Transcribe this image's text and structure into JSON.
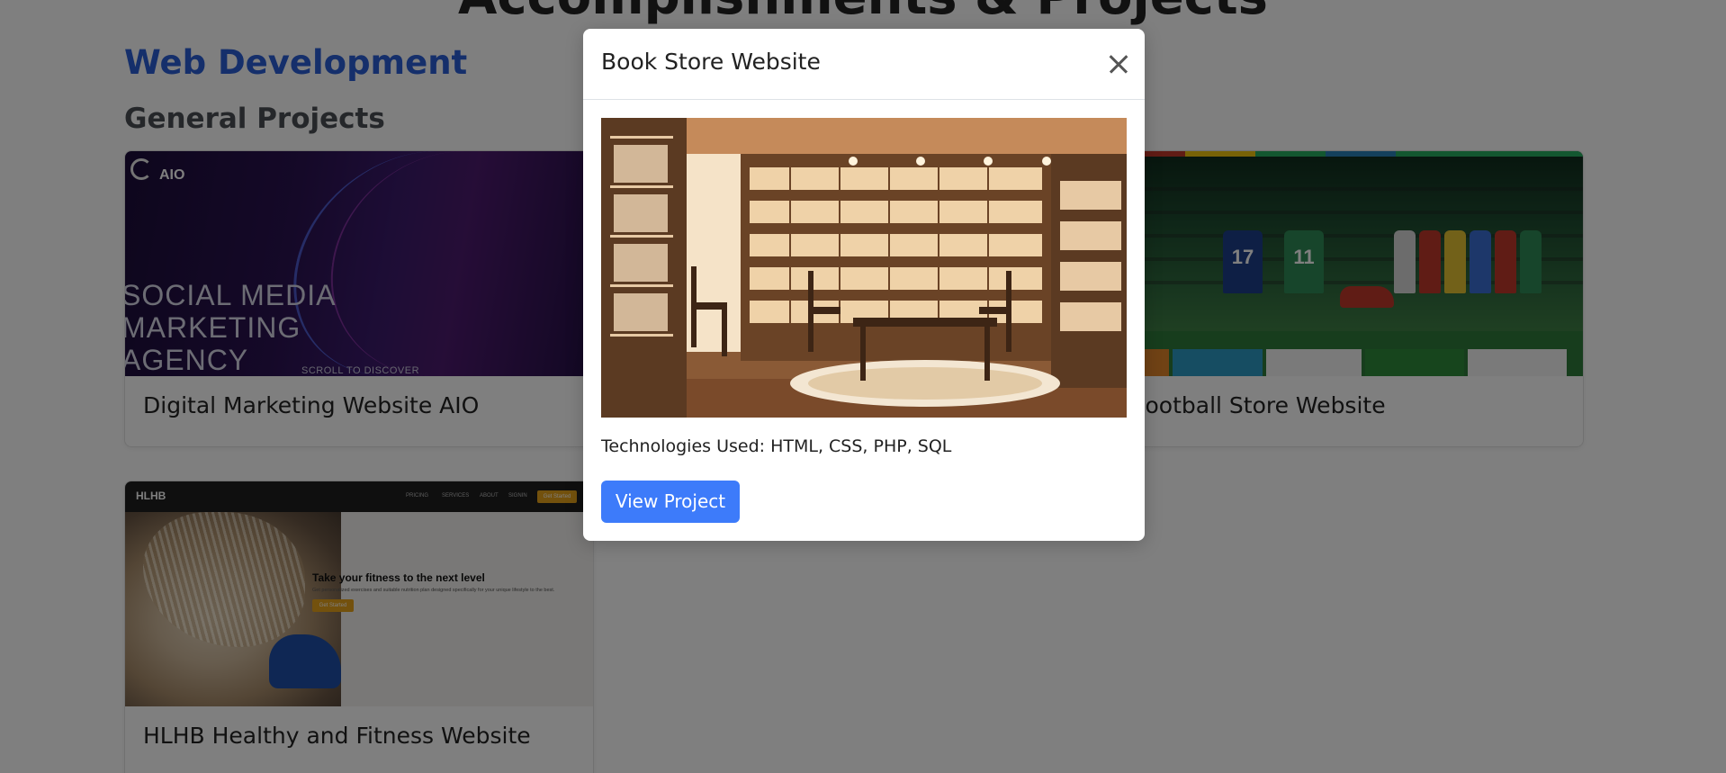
{
  "page": {
    "heading": "Accomplishments & Projects",
    "section_title": "Web Development",
    "subsection_title": "General Projects"
  },
  "cards": [
    {
      "title": "Digital Marketing Website AIO",
      "thumbnail": {
        "logo": "AIO",
        "headline_lines": [
          "SOCIAL MEDIA",
          "MARKETING",
          "AGENCY"
        ],
        "scroll_text": "SCROLL TO DISCOVER"
      }
    },
    {
      "title": "Football Store Website",
      "thumbnail": {
        "shirt_numbers": [
          "17",
          "11"
        ]
      }
    },
    {
      "title": "HLHB Healthy and Fitness Website",
      "thumbnail": {
        "brand": "HLHB",
        "nav_items": [
          "PRICING",
          "SERVICES",
          "ABOUT",
          "SIGNIN"
        ],
        "nav_cta": "Get Started",
        "headline": "Take your fitness to the next level",
        "subtext": "Get personalized exercises and suitable nutrition plan designed specifically for your unique lifestyle to the best.",
        "button": "Get Started"
      }
    }
  ],
  "modal": {
    "title": "Book Store Website",
    "technologies": "Technologies Used: HTML, CSS, PHP, SQL",
    "button_label": "View Project",
    "image_icon": "bookstore-illustration"
  },
  "colors": {
    "accent_blue": "#2a5fd6",
    "button_blue": "#3d7bfa",
    "backdrop": "rgba(0,0,0,0.5)"
  }
}
